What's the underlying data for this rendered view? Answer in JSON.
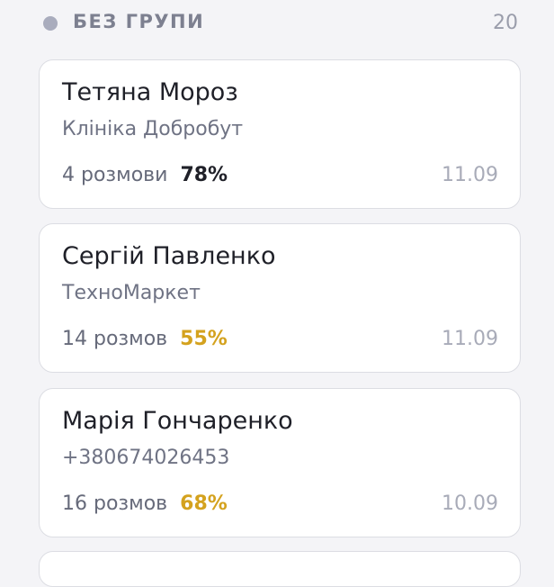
{
  "group": {
    "title": "БЕЗ ГРУПИ",
    "count": "20",
    "dot_color": "#a9acbd"
  },
  "contacts": [
    {
      "name": "Тетяна Мороз",
      "subtitle": "Клініка Добробут",
      "conversations": "4 розмови",
      "score": "78%",
      "score_color": "#1f2028",
      "date": "11.09"
    },
    {
      "name": "Сергій Павленко",
      "subtitle": "ТехноМаркет",
      "conversations": "14 розмов",
      "score": "55%",
      "score_color": "#d4a21e",
      "date": "11.09"
    },
    {
      "name": "Марія Гончаренко",
      "subtitle": "+380674026453",
      "conversations": "16 розмов",
      "score": "68%",
      "score_color": "#d4a21e",
      "date": "10.09"
    }
  ]
}
